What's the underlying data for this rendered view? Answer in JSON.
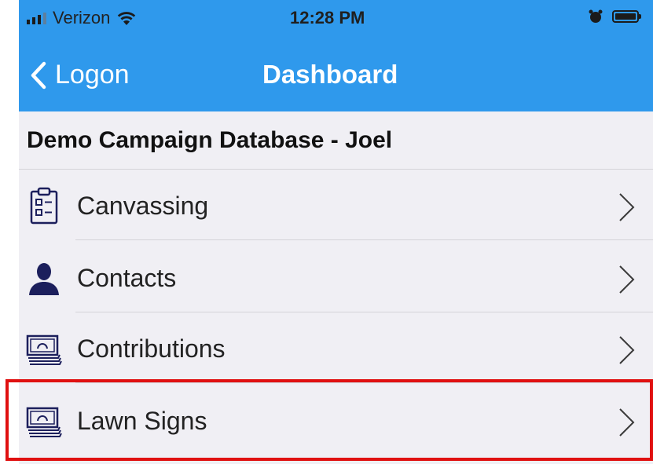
{
  "status_bar": {
    "carrier": "Verizon",
    "time": "12:28 PM"
  },
  "nav": {
    "back_label": "Logon",
    "title": "Dashboard"
  },
  "header": {
    "database_title": "Demo Campaign Database - Joel"
  },
  "menu": {
    "items": [
      {
        "label": "Canvassing",
        "icon": "clipboard-checklist-icon"
      },
      {
        "label": "Contacts",
        "icon": "person-icon"
      },
      {
        "label": "Contributions",
        "icon": "money-bills-icon"
      },
      {
        "label": "Lawn Signs",
        "icon": "money-bills-icon"
      }
    ]
  },
  "colors": {
    "nav_background": "#2f99ec",
    "list_background": "#f0eff4",
    "highlight_border": "#e01010",
    "icon_color": "#1c1f5c"
  }
}
